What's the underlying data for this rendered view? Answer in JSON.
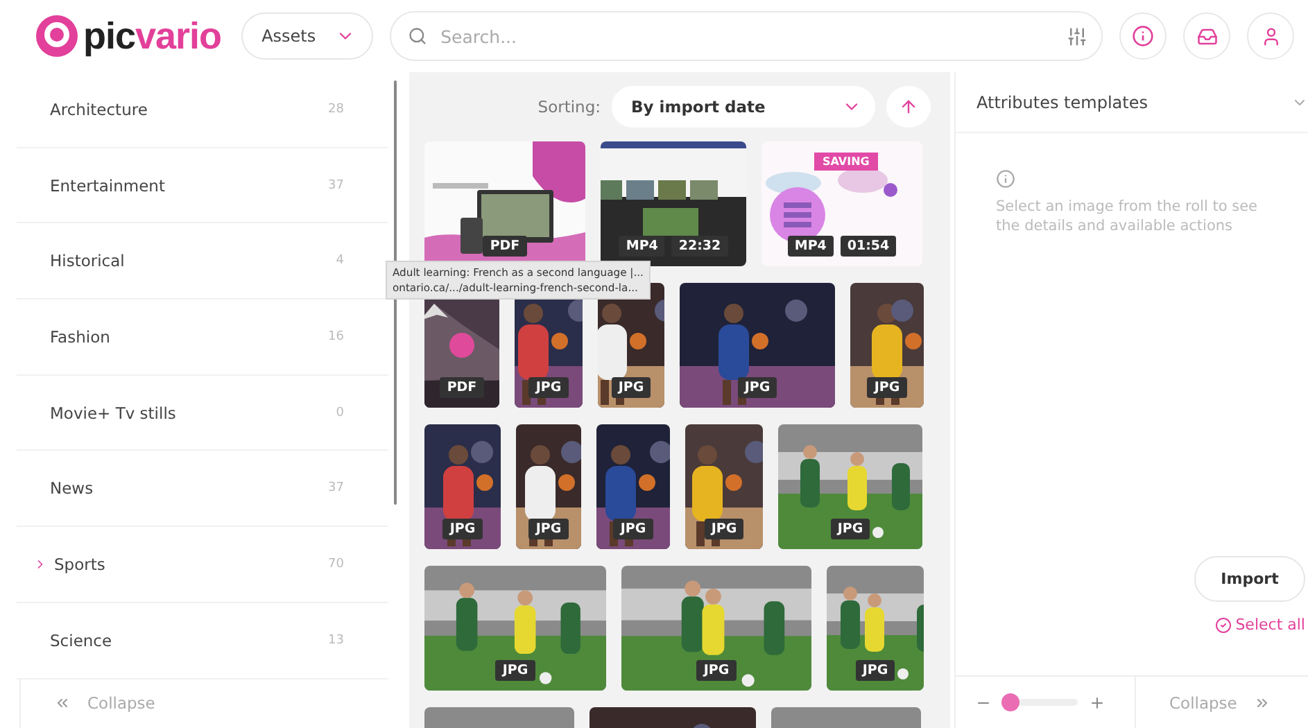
{
  "header": {
    "logo": {
      "first": "pic",
      "second": "vario"
    },
    "section_select": "Assets",
    "search": {
      "placeholder": "Search..."
    }
  },
  "sidebar": {
    "items": [
      {
        "label": "Architecture",
        "count": "28",
        "expandable": false
      },
      {
        "label": "Entertainment",
        "count": "37",
        "expandable": false
      },
      {
        "label": "Historical",
        "count": "4",
        "expandable": false
      },
      {
        "label": "Fashion",
        "count": "16",
        "expandable": false
      },
      {
        "label": "Movie+ Tv stills",
        "count": "0",
        "expandable": false
      },
      {
        "label": "News",
        "count": "37",
        "expandable": false
      },
      {
        "label": "Sports",
        "count": "70",
        "expandable": true
      },
      {
        "label": "Science",
        "count": "13",
        "expandable": false
      }
    ],
    "collapse": "Collapse"
  },
  "gallery": {
    "sorting_label": "Sorting:",
    "sorting_value": "By import date",
    "rows": [
      [
        {
          "kind": "document",
          "badges": [
            "PDF"
          ]
        },
        {
          "kind": "video",
          "badges": [
            "MP4",
            "22:32"
          ]
        },
        {
          "kind": "saving",
          "status": "SAVING",
          "badges": [
            "MP4",
            "01:54"
          ]
        }
      ],
      [
        {
          "kind": "mountain",
          "badges": [
            "PDF"
          ]
        },
        {
          "kind": "basketball",
          "badges": [
            "JPG"
          ]
        },
        {
          "kind": "basketball",
          "badges": [
            "JPG"
          ]
        },
        {
          "kind": "basketball",
          "badges": [
            "JPG"
          ]
        },
        {
          "kind": "basketball",
          "badges": [
            "JPG"
          ]
        }
      ],
      [
        {
          "kind": "basketball",
          "badges": [
            "JPG"
          ]
        },
        {
          "kind": "basketball",
          "badges": [
            "JPG"
          ]
        },
        {
          "kind": "basketball",
          "badges": [
            "JPG"
          ]
        },
        {
          "kind": "basketball",
          "badges": [
            "JPG"
          ]
        },
        {
          "kind": "soccer",
          "badges": [
            "JPG"
          ]
        }
      ],
      [
        {
          "kind": "soccer",
          "badges": [
            "JPG"
          ]
        },
        {
          "kind": "soccer",
          "badges": [
            "JPG"
          ]
        },
        {
          "kind": "soccer",
          "badges": [
            "JPG"
          ]
        }
      ],
      [
        {
          "kind": "soccer"
        },
        {
          "kind": "basketball"
        },
        {
          "kind": "soccer"
        }
      ]
    ],
    "tooltip": {
      "title": "Adult learning: French as a second language |...",
      "url": "ontario.ca/.../adult-learning-french-second-la..."
    }
  },
  "details": {
    "title": "Attributes templates",
    "message": "Select an image from the roll to see the details and available actions",
    "import": "Import",
    "select_all": "Select all",
    "zoom": {
      "level": 0.1
    },
    "collapse": "Collapse"
  }
}
